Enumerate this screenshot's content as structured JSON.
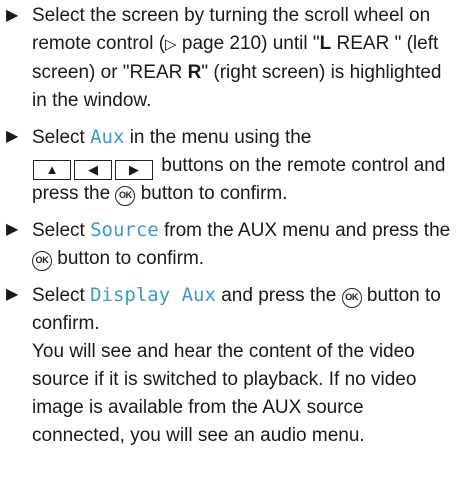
{
  "bullet_glyph": "▶",
  "step1": {
    "text_a": "Select the screen by turning the scroll wheel on remote control (",
    "ref_symbol": "▷",
    "text_b": " page 210) until \"",
    "left_letter": "L",
    "text_c": " REAR \" (left screen) or \"REAR ",
    "right_letter": "R",
    "text_d": "\" (right screen) is highlighted in the window."
  },
  "step2": {
    "text_a": "Select ",
    "menu_item": "Aux",
    "text_b": " in the menu using the",
    "key_up": "▲",
    "key_left": "◀",
    "key_right": "▶",
    "text_c": " buttons on the remote control and press the ",
    "ok_label": "OK",
    "text_d": " button to confirm."
  },
  "step3": {
    "text_a": "Select ",
    "menu_item": "Source",
    "text_b": " from the AUX menu and press the ",
    "ok_label": "OK",
    "text_c": " button to confirm."
  },
  "step4": {
    "text_a": "Select ",
    "menu_item": "Display Aux",
    "text_b": " and press the ",
    "ok_label": "OK",
    "text_c": " button to confirm.",
    "result": "You will see and hear the content of the video source if it is switched to playback. If no video image is available from the AUX source connected, you will see an audio menu."
  }
}
